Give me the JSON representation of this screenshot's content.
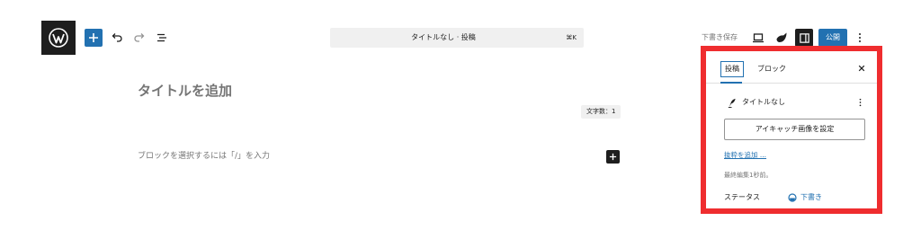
{
  "toolbar": {
    "logo": "wordpress-logo",
    "add_icon": "plus-icon",
    "undo_icon": "undo-icon",
    "redo_icon": "redo-icon",
    "outline_icon": "list-view-icon",
    "command_title": "タイトルなし · 投稿",
    "command_shortcut": "⌘K",
    "save_draft_label": "下書き保存",
    "view_icon": "desktop-preview-icon",
    "styles_icon": "styles-icon",
    "settings_icon": "sidebar-toggle-icon",
    "publish_label": "公開",
    "more_icon": "more-vertical-icon"
  },
  "editor": {
    "title_placeholder": "タイトルを追加",
    "word_count": "文字数：1",
    "block_placeholder": "ブロックを選択するには「/」を入力"
  },
  "sidebar": {
    "tabs": [
      {
        "label": "投稿",
        "active": true
      },
      {
        "label": "ブロック",
        "active": false
      }
    ],
    "close_icon": "close-icon",
    "post_title": "タイトルなし",
    "featured_image_label": "アイキャッチ画像を設定",
    "excerpt_link": "抜粋を追加 ...",
    "last_edited": "最終編集1秒前。",
    "status_label": "ステータス",
    "status_value": "下書き"
  },
  "colors": {
    "accent": "#2271b1",
    "highlight_frame": "#ef2d2f",
    "dark": "#1e1e1e"
  }
}
